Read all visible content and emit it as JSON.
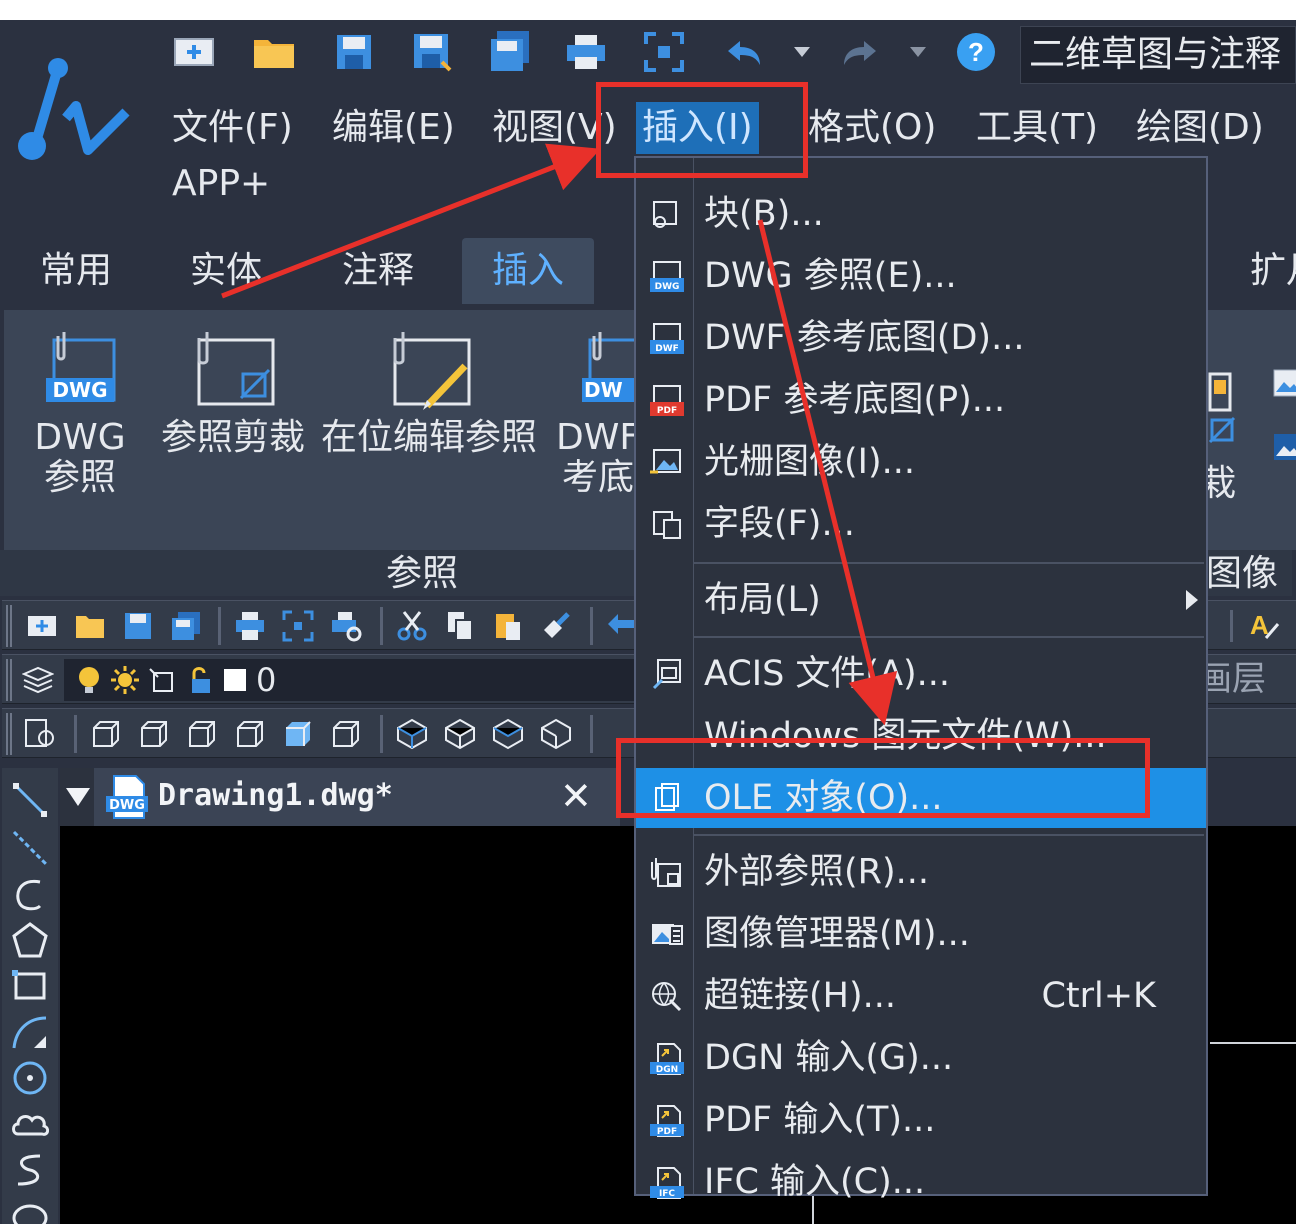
{
  "workspace": "二维草图与注释",
  "menu": {
    "items": [
      "文件(F)",
      "编辑(E)",
      "视图(V)",
      "插入(I)",
      "格式(O)",
      "工具(T)",
      "绘图(D)"
    ],
    "app_plus": "APP+"
  },
  "ribbon": {
    "tabs": [
      "常用",
      "实体",
      "注释",
      "插入",
      "扩月"
    ],
    "active_tab": "插入",
    "buttons": [
      {
        "line1": "DWG",
        "line2": "参照",
        "icon_text": "DWG"
      },
      {
        "line1": "参照剪裁",
        "line2": ""
      },
      {
        "line1": "在位编辑参照",
        "line2": ""
      },
      {
        "line1": "DWF",
        "line2": "考底",
        "icon_text": "DW"
      }
    ],
    "panel_label": "参照",
    "right_partial": {
      "button": "栽",
      "panel": "图像"
    }
  },
  "layer_toolbar": {
    "layer_name": "0",
    "right_text": "画层"
  },
  "document_tab": {
    "filename": "Drawing1.dwg*",
    "icon_text": "DWG",
    "close": "✕"
  },
  "dropdown": {
    "items": [
      {
        "label": "块(B)...",
        "icon": "block-icon",
        "icon_text": ""
      },
      {
        "label": "DWG 参照(E)...",
        "icon": "dwg-ref-icon",
        "icon_text": "DWG"
      },
      {
        "label": "DWF 参考底图(D)...",
        "icon": "dwf-underlay-icon",
        "icon_text": "DWF"
      },
      {
        "label": "PDF 参考底图(P)...",
        "icon": "pdf-underlay-icon",
        "icon_text": "PDF"
      },
      {
        "label": "光栅图像(I)...",
        "icon": "raster-image-icon",
        "icon_text": ""
      },
      {
        "label": "字段(F)...",
        "icon": "field-icon",
        "icon_text": ""
      },
      {
        "label": "布局(L)",
        "icon": "",
        "icon_text": "",
        "submenu": true
      },
      {
        "label": "ACIS 文件(A)...",
        "icon": "acis-icon",
        "icon_text": ""
      },
      {
        "label": "Windows 图元文件(W)...",
        "icon": "",
        "icon_text": ""
      },
      {
        "label": "OLE 对象(O)...",
        "icon": "ole-object-icon",
        "icon_text": "",
        "highlighted": true
      },
      {
        "label": "外部参照(R)...",
        "icon": "xref-icon",
        "icon_text": ""
      },
      {
        "label": "图像管理器(M)...",
        "icon": "image-manager-icon",
        "icon_text": ""
      },
      {
        "label": "超链接(H)...",
        "icon": "hyperlink-icon",
        "icon_text": "",
        "shortcut": "Ctrl+K"
      },
      {
        "label": "DGN 输入(G)...",
        "icon": "dgn-import-icon",
        "icon_text": "DGN"
      },
      {
        "label": "PDF 输入(T)...",
        "icon": "pdf-import-icon",
        "icon_text": "PDF"
      },
      {
        "label": "IFC 输入(C)...",
        "icon": "ifc-import-icon",
        "icon_text": "IFC"
      }
    ]
  },
  "colors": {
    "background": "#2b3140",
    "highlight": "#1e90e6",
    "annotation_red": "#e8302a",
    "active_tab_text": "#5fb1ff"
  }
}
